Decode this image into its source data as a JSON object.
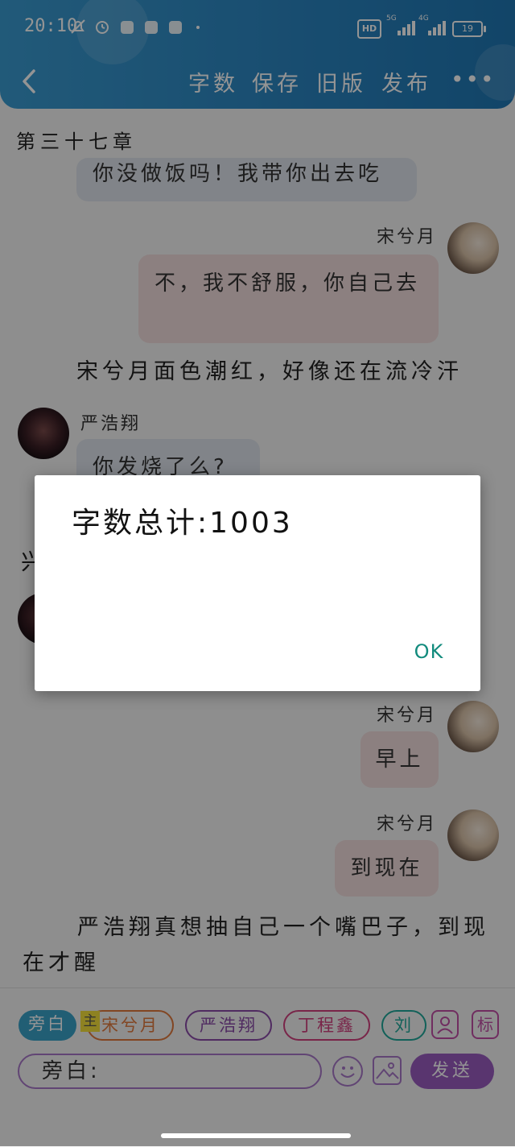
{
  "status_bar": {
    "time": "20:10",
    "hd": "HD",
    "net1": "5G",
    "net2": "4G",
    "battery": "19"
  },
  "header": {
    "back_icon": "chevron-left-icon",
    "buttons": [
      "字数",
      "保存",
      "旧版",
      "发布"
    ],
    "more_icon": "more-dots-icon",
    "more_label": "•••"
  },
  "chapter_title": "第三十七章",
  "messages": [
    {
      "kind": "bubble-left",
      "text": "你没做饭吗！我带你出去吃"
    },
    {
      "kind": "bubble-right",
      "name": "宋兮月",
      "text": "不，我不舒服，你自己去"
    },
    {
      "kind": "narration",
      "text": "宋兮月面色潮红，好像还在流冷汗"
    },
    {
      "kind": "bubble-left",
      "name": "严浩翔",
      "text": "你发烧了么?"
    },
    {
      "kind": "bubble-right",
      "name": "宋兮月",
      "text": "早上"
    },
    {
      "kind": "bubble-right",
      "name": "宋兮月",
      "text": "到现在"
    },
    {
      "kind": "narration",
      "text": "严浩翔真想抽自己一个嘴巴子，到现在才醒"
    }
  ],
  "dialog": {
    "text": "字数总计:1003",
    "ok_label": "OK"
  },
  "role_bar": {
    "chips": [
      "旁白",
      "宋兮月",
      "严浩翔",
      "丁程鑫",
      "刘"
    ],
    "main_tag": "主",
    "person_icon": "person-icon",
    "tag_label": "标"
  },
  "composer": {
    "input_value": "旁白:",
    "emoji_icon": "smile-icon",
    "image_icon": "image-icon",
    "send_label": "发送"
  },
  "colors": {
    "header": "#2b86c2",
    "accent": "#9a5cc0",
    "ok": "#128b7d"
  }
}
